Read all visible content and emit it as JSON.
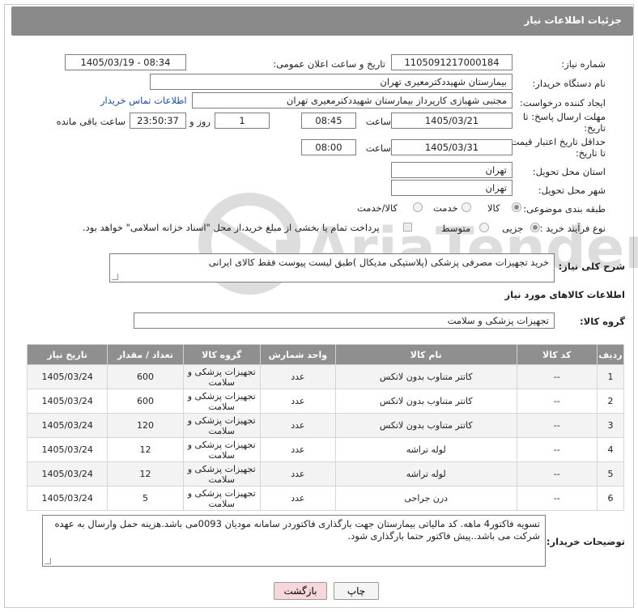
{
  "header": {
    "title": "جزئیات اطلاعات نیاز"
  },
  "form": {
    "need_number_label": "شماره نیاز:",
    "need_number": "1105091217000184",
    "announce_label": "تاریخ و ساعت اعلان عمومی:",
    "announce_value": "1405/03/19 - 08:34",
    "buyer_org_label": "نام دستگاه خریدار:",
    "buyer_org": "بیمارستان شهیددکترمعیری تهران",
    "requester_label": "ایجاد کننده درخواست:",
    "requester": "مجتبی  شهبازی کارپرداز بیمارستان شهیددکترمعیری تهران",
    "buyer_contact_link": "اطلاعات تماس خریدار",
    "deadline_label_1": "مهلت ارسال پاسخ: تا",
    "deadline_label_2": "تاریخ:",
    "deadline_date": "1405/03/21",
    "time_label": "ساعت",
    "deadline_time": "08:45",
    "deadline_days": "1",
    "days_and_label": "روز و",
    "remaining_time": "23:50:37",
    "remaining_label": "ساعت باقی مانده",
    "price_label_1": "حداقل تاریخ اعتبار قیمت:",
    "price_label_2": "تا تاریخ:",
    "price_date": "1405/03/31",
    "price_time": "08:00",
    "province_label": "استان محل تحویل:",
    "province": "تهران",
    "city_label": "شهر محل تحویل:",
    "city": "تهران",
    "category_label": "طبقه بندی موضوعی:",
    "category_options": [
      "کالا",
      "خدمت",
      "کالا/خدمت"
    ],
    "process_label": "نوع فرآیند خرید :",
    "process_options": [
      "جزیی",
      "متوسط"
    ],
    "payment_note": "پرداخت تمام یا بخشی از مبلغ خرید،از محل \"اسناد خزانه اسلامی\" خواهد بود."
  },
  "description": {
    "label": "شرح کلی نیاز:",
    "text": "خرید تجهیزات مصرفی پزشکی (پلاستیکی مدیکال )طبق لیست پیوست فقط کالای ایرانی"
  },
  "goods": {
    "section_title": "اطلاعات کالاهای مورد نیاز",
    "group_label": "گروه کالا:",
    "group_value": "تجهیزات پزشکی و سلامت"
  },
  "table": {
    "headers": [
      "ردیف",
      "کد کالا",
      "نام کالا",
      "واحد شمارش",
      "گروه کالا",
      "تعداد / مقدار",
      "تاریخ نیاز"
    ],
    "rows": [
      [
        "1",
        "--",
        "کاتتر متناوب بدون لاتکس",
        "عدد",
        "تجهیزات پزشکی و سلامت",
        "600",
        "1405/03/24"
      ],
      [
        "2",
        "--",
        "کاتتر متناوب بدون لاتکس",
        "عدد",
        "تجهیزات پزشکی و سلامت",
        "600",
        "1405/03/24"
      ],
      [
        "3",
        "--",
        "کاتتر متناوب بدون لاتکس",
        "عدد",
        "تجهیزات پزشکی و سلامت",
        "120",
        "1405/03/24"
      ],
      [
        "4",
        "--",
        "لوله تراشه",
        "عدد",
        "تجهیزات پزشکی و سلامت",
        "12",
        "1405/03/24"
      ],
      [
        "5",
        "--",
        "لوله تراشه",
        "عدد",
        "تجهیزات پزشکی و سلامت",
        "12",
        "1405/03/24"
      ],
      [
        "6",
        "--",
        "درن جراحی",
        "عدد",
        "تجهیزات پزشکی و سلامت",
        "5",
        "1405/03/24"
      ]
    ]
  },
  "buyer_notes": {
    "label": "توضیحات خریدار:",
    "text": "تسویه فاکتور4 ماهه. کد مالیاتی بیمارستان جهت بارگذاری فاکتوردر سامانه مودیان 0093می باشد.هزینه حمل وارسال به عهده شرکت می باشد..پیش فاکتور حتما بارگذاری شود."
  },
  "buttons": {
    "print": "چاپ",
    "back": "بازگشت"
  },
  "watermark": {
    "text": "AriaTender.net"
  },
  "colors": {
    "header_bg": "#8a8a8a",
    "link": "#1a4fa0",
    "back_button_bg": "#f7d6dc"
  }
}
